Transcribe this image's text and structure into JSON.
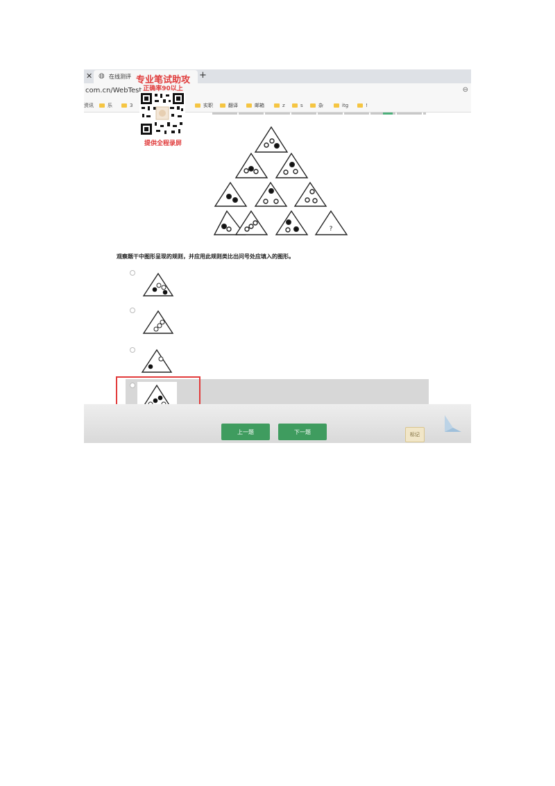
{
  "browser": {
    "tab_title": "在线测评",
    "address": "com.cn/WebTest",
    "bookmarks": [
      "资讯",
      "乐",
      "3",
      "实职",
      "翻译",
      "邮箱",
      "z",
      "s",
      "杂",
      "itg",
      "!"
    ]
  },
  "watermark": {
    "line1": "专业笔试助攻",
    "line2": "正确率90以上",
    "line3": "提供全程录屏"
  },
  "question": {
    "prompt": "观察题干中图形呈现的规则，并应用此规则类比出问号处应填入的图形。",
    "missing_mark": "?"
  },
  "nav": {
    "prev": "上一题",
    "next": "下一题",
    "mark": "标记"
  },
  "colors": {
    "nav_button": "#3f9c5f",
    "highlight": "#e23a3a",
    "selected_option": "#d7d7d7",
    "watermark": "#e03b3b"
  }
}
